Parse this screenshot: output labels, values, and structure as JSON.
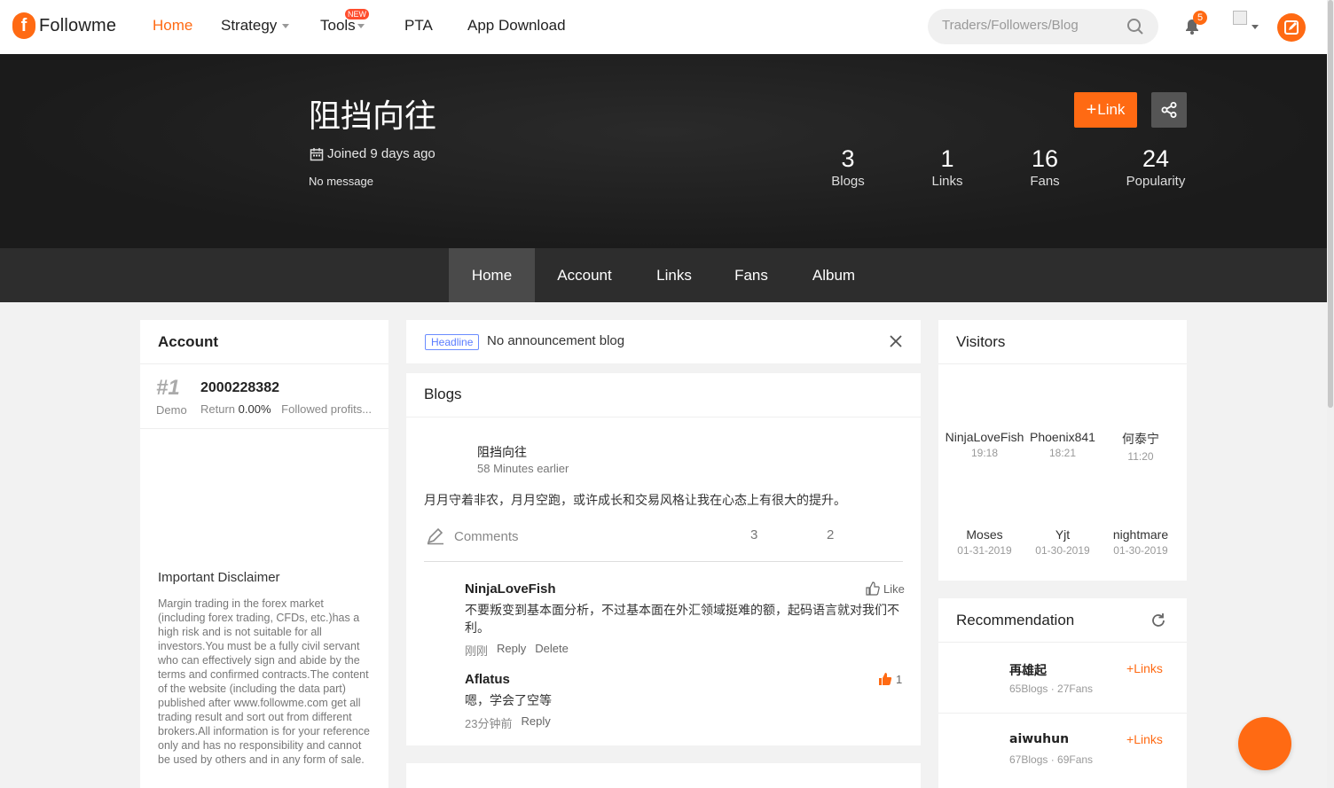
{
  "nav": {
    "logo_letter": "f",
    "logo_text": "Followme",
    "items": [
      {
        "label": "Home"
      },
      {
        "label": "Strategy"
      },
      {
        "label": "Tools"
      },
      {
        "label": "PTA"
      },
      {
        "label": "App Download"
      }
    ],
    "new_badge": "NEW",
    "search_placeholder": "Traders/Followers/Blog",
    "notification_count": "5"
  },
  "profile": {
    "name": "阻挡向往",
    "joined": "Joined 9 days ago",
    "message": "No message",
    "link_button": "Link",
    "stats": [
      {
        "value": "3",
        "label": "Blogs"
      },
      {
        "value": "1",
        "label": "Links"
      },
      {
        "value": "16",
        "label": "Fans"
      },
      {
        "value": "24",
        "label": "Popularity"
      }
    ]
  },
  "tabs": [
    {
      "label": "Home"
    },
    {
      "label": "Account"
    },
    {
      "label": "Links"
    },
    {
      "label": "Fans"
    },
    {
      "label": "Album"
    }
  ],
  "account": {
    "title": "Account",
    "rank": "#1",
    "type": "Demo",
    "number": "2000228382",
    "return_label": "Return",
    "return_value": "0.00%",
    "followed": "Followed profits...",
    "disclaimer_title": "Important Disclaimer",
    "disclaimer_text": "Margin trading in the forex market (including forex trading, CFDs, etc.)has a high risk and is not suitable for all investors.You must be a fully civil servant who can effectively sign and abide by the terms and confirmed contracts.The content of the website (including the data part) published after www.followme.com get all trading result and sort out from different brokers.All information is for your reference only and has no responsibility and cannot be used by others and in any form of sale."
  },
  "announcement": {
    "tag": "Headline",
    "text": "No announcement blog"
  },
  "blogs": {
    "title": "Blogs",
    "post": {
      "author": "阻挡向往",
      "time": "58 Minutes earlier",
      "body": "月月守着非农，月月空跑，或许成长和交易风格让我在心态上有很大的提升。",
      "comments_label": "Comments",
      "count_a": "3",
      "count_b": "2"
    },
    "comments": [
      {
        "name": "NinjaLoveFish",
        "text": "不要叛变到基本面分析，不过基本面在外汇领域挺难的额，起码语言就对我们不利。",
        "time": "刚刚",
        "reply": "Reply",
        "delete": "Delete",
        "like_label": "Like"
      },
      {
        "name": "Aflatus",
        "text": "嗯，学会了空等",
        "time": "23分钟前",
        "reply": "Reply",
        "like_count": "1"
      }
    ]
  },
  "visitors": {
    "title": "Visitors",
    "items": [
      {
        "name": "NinjaLoveFish",
        "time": "19:18"
      },
      {
        "name": "Phoenix841",
        "time": "18:21"
      },
      {
        "name": "何泰宁",
        "time": "11:20"
      },
      {
        "name": "Moses",
        "time": "01-31-2019"
      },
      {
        "name": "Yjt",
        "time": "01-30-2019"
      },
      {
        "name": "nightmare",
        "time": "01-30-2019"
      }
    ]
  },
  "recommendation": {
    "title": "Recommendation",
    "items": [
      {
        "name": "再雄起",
        "meta": "65Blogs · 27Fans",
        "link": "Links"
      },
      {
        "name": "aiwuhun",
        "meta": "67Blogs · 69Fans",
        "link": "Links"
      }
    ]
  },
  "colors": {
    "accent": "#ff6a13",
    "banner": "#1b1b1b",
    "tabbar": "#2d2d2d"
  }
}
